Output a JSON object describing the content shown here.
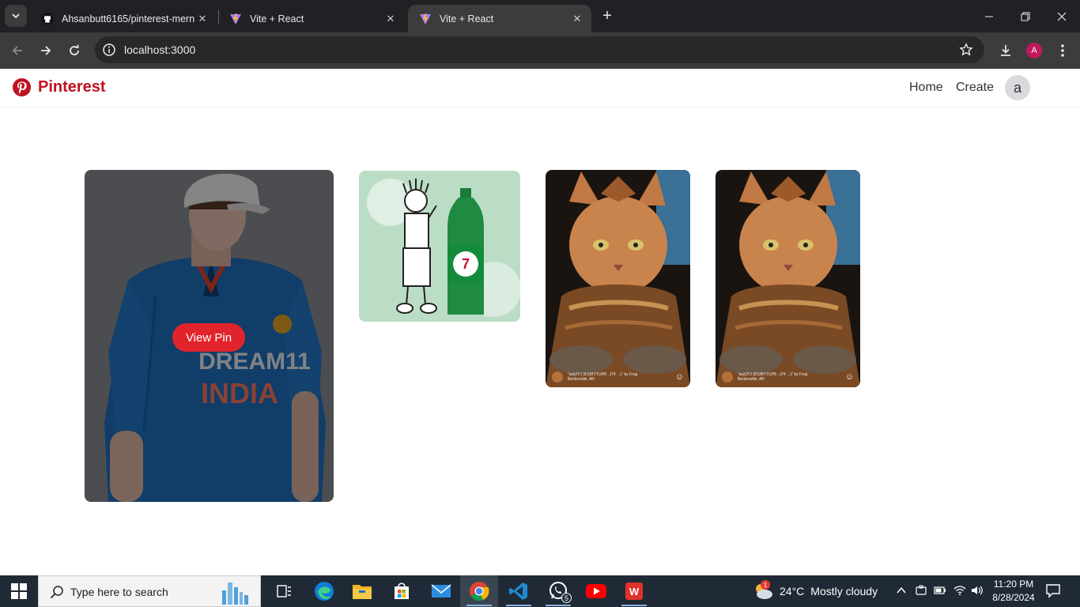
{
  "browser": {
    "tabs": [
      {
        "title": "Ahsanbutt6165/pinterest-mern",
        "favicon": "github-icon",
        "active": false
      },
      {
        "title": "Vite + React",
        "favicon": "vite-icon",
        "active": false
      },
      {
        "title": "Vite + React",
        "favicon": "vite-icon",
        "active": true
      }
    ],
    "url": "localhost:3000",
    "profile_initial": "A",
    "colors": {
      "tabbar": "#202124",
      "toolbar": "#3c3c3c",
      "profile": "#c2185b"
    }
  },
  "app": {
    "brand": "Pinterest",
    "brand_color": "#c0121f",
    "nav": {
      "home": "Home",
      "create": "Create"
    },
    "avatar_initial": "a"
  },
  "pins": [
    {
      "image": "cricket-jersey-model",
      "hovered": true,
      "action_label": "View Pin",
      "jersey_line1": "DREAM11",
      "jersey_line2": "INDIA"
    },
    {
      "image": "7up-fido-bottle"
    },
    {
      "image": "armored-cat",
      "caption": "\"aojUYJ 3DUBYTUP8→[?4 →j\" by Frog",
      "location": "Bentonville, AR"
    },
    {
      "image": "armored-cat",
      "caption": "\"aojUYJ 3DUBYTUP8→[?4 →j\" by Frog",
      "location": "Bentonville, AR"
    }
  ],
  "accent": "#e1242c",
  "taskbar": {
    "search_placeholder": "Type here to search",
    "apps": [
      "task-view-icon",
      "edge-icon",
      "file-explorer-icon",
      "store-icon",
      "mail-icon",
      "chrome-icon",
      "vscode-icon",
      "whatsapp-icon",
      "youtube-icon",
      "wps-icon"
    ],
    "whatsapp_badge": "5",
    "weather_badge": "1",
    "weather": {
      "temp": "24°C",
      "condition": "Mostly cloudy"
    },
    "time": "11:20 PM",
    "date": "8/28/2024"
  }
}
